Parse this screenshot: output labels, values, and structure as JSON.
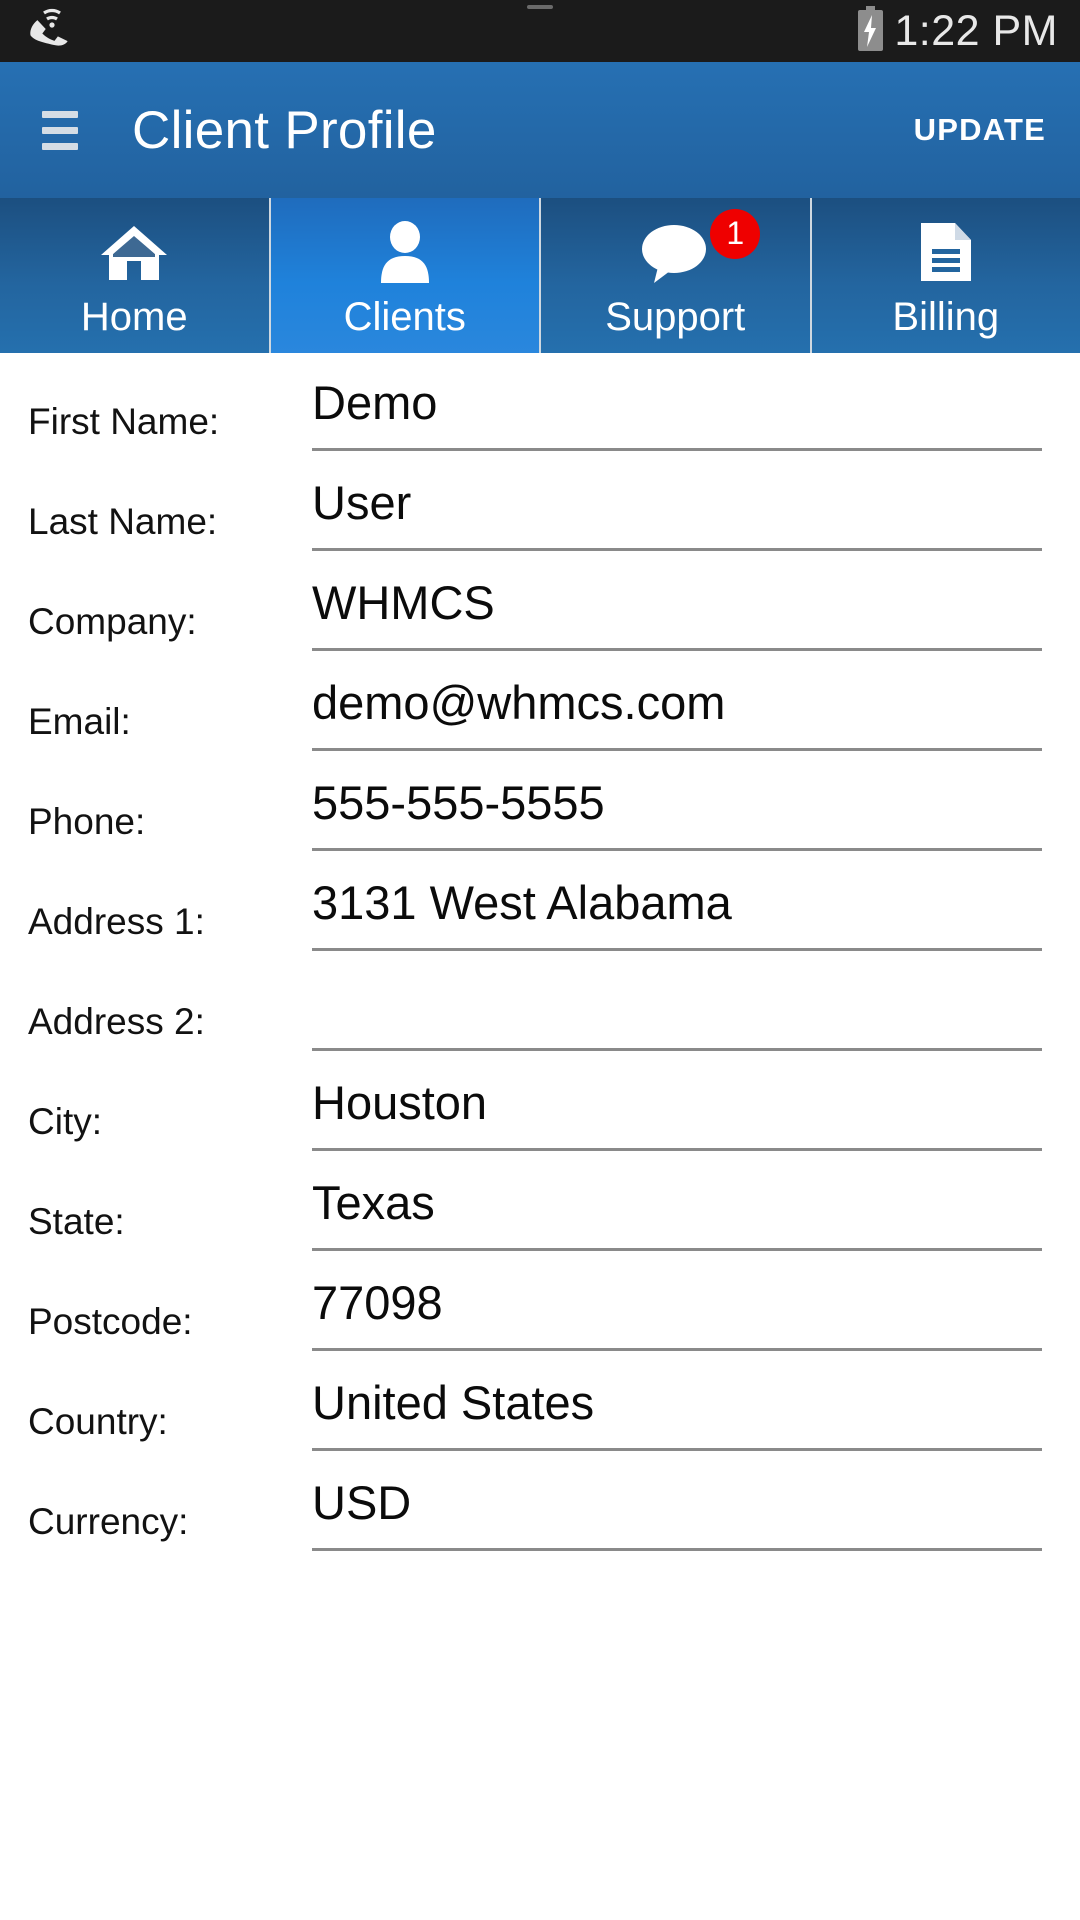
{
  "statusbar": {
    "wifi_call_icon": "wifi-calling-icon",
    "battery_icon": "battery-charging-icon",
    "clock": "1:22 PM"
  },
  "appbar": {
    "menu_icon": "hamburger-menu-icon",
    "title": "Client Profile",
    "action_label": "UPDATE"
  },
  "tabs": [
    {
      "label": "Home",
      "icon": "home-icon",
      "selected": false,
      "badge": ""
    },
    {
      "label": "Clients",
      "icon": "person-icon",
      "selected": true,
      "badge": ""
    },
    {
      "label": "Support",
      "icon": "speech-bubble-icon",
      "selected": false,
      "badge": "1"
    },
    {
      "label": "Billing",
      "icon": "document-icon",
      "selected": false,
      "badge": ""
    }
  ],
  "form": {
    "fields": [
      {
        "label": "First Name:",
        "value": "Demo"
      },
      {
        "label": "Last Name:",
        "value": "User"
      },
      {
        "label": "Company:",
        "value": "WHMCS"
      },
      {
        "label": "Email:",
        "value": "demo@whmcs.com"
      },
      {
        "label": "Phone:",
        "value": "555-555-5555"
      },
      {
        "label": "Address 1:",
        "value": "3131 West Alabama"
      },
      {
        "label": "Address 2:",
        "value": ""
      },
      {
        "label": "City:",
        "value": "Houston"
      },
      {
        "label": "State:",
        "value": "Texas"
      },
      {
        "label": "Postcode:",
        "value": "77098"
      },
      {
        "label": "Country:",
        "value": "United States"
      },
      {
        "label": "Currency:",
        "value": "USD"
      }
    ]
  },
  "colors": {
    "statusbar_bg": "#1b1b1b",
    "appbar_bg": "#2670b3",
    "tabbar_bg": "#23659f",
    "tab_selected_bg": "#1f82db",
    "badge_bg": "#ef0000",
    "underline": "#8a8a8a"
  }
}
